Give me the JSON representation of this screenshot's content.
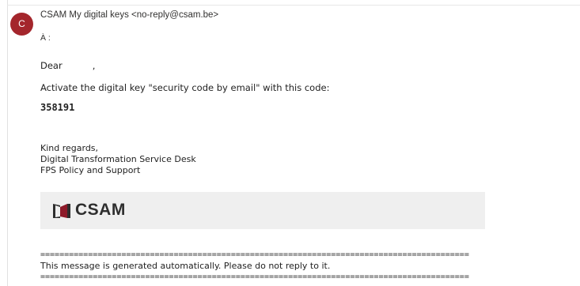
{
  "email": {
    "avatar_initial": "C",
    "sender": "CSAM My digital keys <no-reply@csam.be>",
    "recipient_label": "À :",
    "greeting": "Dear",
    "greeting_suffix": ",",
    "instruction": "Activate the digital key \"security code by email\" with this code:",
    "code": "358191",
    "signature": [
      "Kind regards,",
      "Digital Transformation Service Desk",
      "FPS Policy and Support"
    ],
    "logo_text": "CSAM",
    "rule": "==========================================================================================",
    "footer_note": "This message is generated automatically. Please do not reply to it."
  },
  "colors": {
    "avatar": "#a4262c",
    "logo_red": "#8e1b2a",
    "logo_box": "#efefef"
  },
  "icons": {
    "logo": "csam-door-logo-icon"
  }
}
